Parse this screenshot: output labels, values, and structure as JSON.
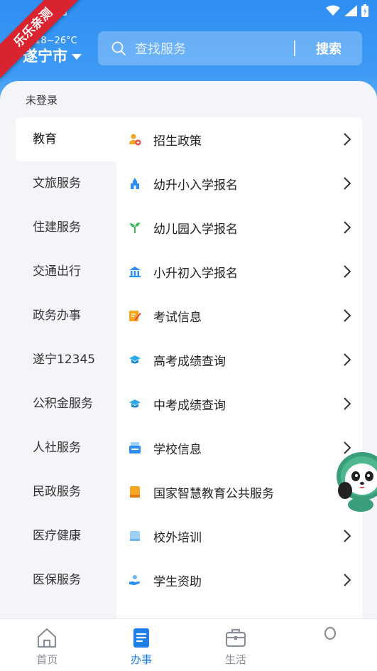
{
  "watermark": {
    "text": "乐乐亲测"
  },
  "header": {
    "weather": "晴 18~26°C",
    "city": "遂宁市",
    "search": {
      "placeholder": "查找服务",
      "button_label": "搜索"
    }
  },
  "login_status": "未登录",
  "categories": [
    {
      "label": "教育",
      "active": true
    },
    {
      "label": "文旅服务"
    },
    {
      "label": "住建服务"
    },
    {
      "label": "交通出行"
    },
    {
      "label": "政务办事"
    },
    {
      "label": "遂宁12345"
    },
    {
      "label": "公积金服务"
    },
    {
      "label": "人社服务"
    },
    {
      "label": "民政服务"
    },
    {
      "label": "医疗健康"
    },
    {
      "label": "医保服务"
    }
  ],
  "services": [
    {
      "label": "招生政策",
      "icon": "person-add-icon",
      "color": "#f5a623"
    },
    {
      "label": "幼升小入学报名",
      "icon": "castle-icon",
      "color": "#2f8ef2"
    },
    {
      "label": "幼儿园入学报名",
      "icon": "sprout-icon",
      "color": "#3dbb5a"
    },
    {
      "label": "小升初入学报名",
      "icon": "building-icon",
      "color": "#2f8ef2"
    },
    {
      "label": "考试信息",
      "icon": "edit-note-icon",
      "color": "#f5a623"
    },
    {
      "label": "高考成绩查询",
      "icon": "graduation-cap-icon",
      "color": "#2fa9e8"
    },
    {
      "label": "中考成绩查询",
      "icon": "graduation-cap-icon",
      "color": "#2fa9e8"
    },
    {
      "label": "学校信息",
      "icon": "school-card-icon",
      "color": "#2f8ef2"
    },
    {
      "label": "国家智慧教育公共服务",
      "icon": "book-icon",
      "color": "#f5a623"
    },
    {
      "label": "校外培训",
      "icon": "card-icon",
      "color": "#9fd1f5"
    },
    {
      "label": "学生资助",
      "icon": "hand-icon",
      "color": "#6ab5f0"
    }
  ],
  "tabs": [
    {
      "label": "首页",
      "icon": "home-icon"
    },
    {
      "label": "办事",
      "icon": "document-icon",
      "active": true
    },
    {
      "label": "生活",
      "icon": "briefcase-icon"
    },
    {
      "label": "",
      "icon": "user-icon"
    }
  ],
  "colors": {
    "primary": "#2f8ef2",
    "active_tab": "#1f7fe8",
    "ribbon": "#d9232e"
  }
}
